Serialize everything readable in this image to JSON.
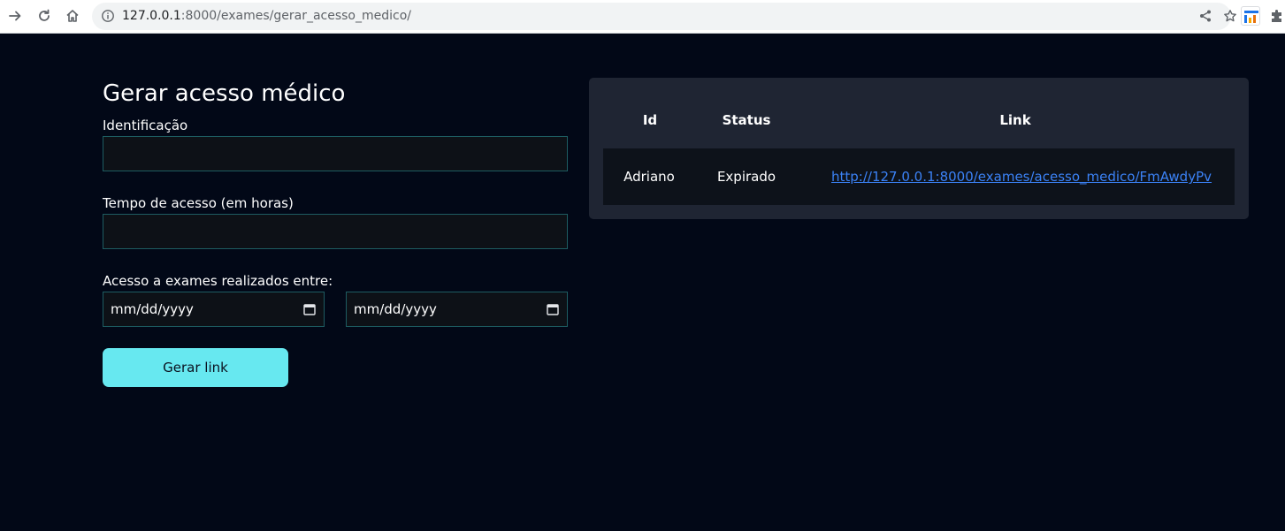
{
  "browser": {
    "url_host": "127.0.0.1",
    "url_rest": ":8000/exames/gerar_acesso_medico/"
  },
  "form": {
    "title": "Gerar acesso médico",
    "identificacao_label": "Identificação",
    "identificacao_value": "",
    "tempo_label": "Tempo de acesso (em horas)",
    "tempo_value": "",
    "periodo_label": "Acesso a exames realizados entre:",
    "data_inicio_placeholder": "mm/dd/yyyy",
    "data_fim_placeholder": "mm/dd/yyyy",
    "submit_label": "Gerar link"
  },
  "table": {
    "headers": [
      "Id",
      "Status",
      "Link"
    ],
    "rows": [
      {
        "id": "Adriano",
        "status": "Expirado",
        "link": "http://127.0.0.1:8000/exames/acesso_medico/FmAwdyPv"
      }
    ]
  },
  "colors": {
    "background": "#020817",
    "accent_button": "#67e8f0",
    "card": "#1f2533",
    "link": "#3b82f6"
  }
}
